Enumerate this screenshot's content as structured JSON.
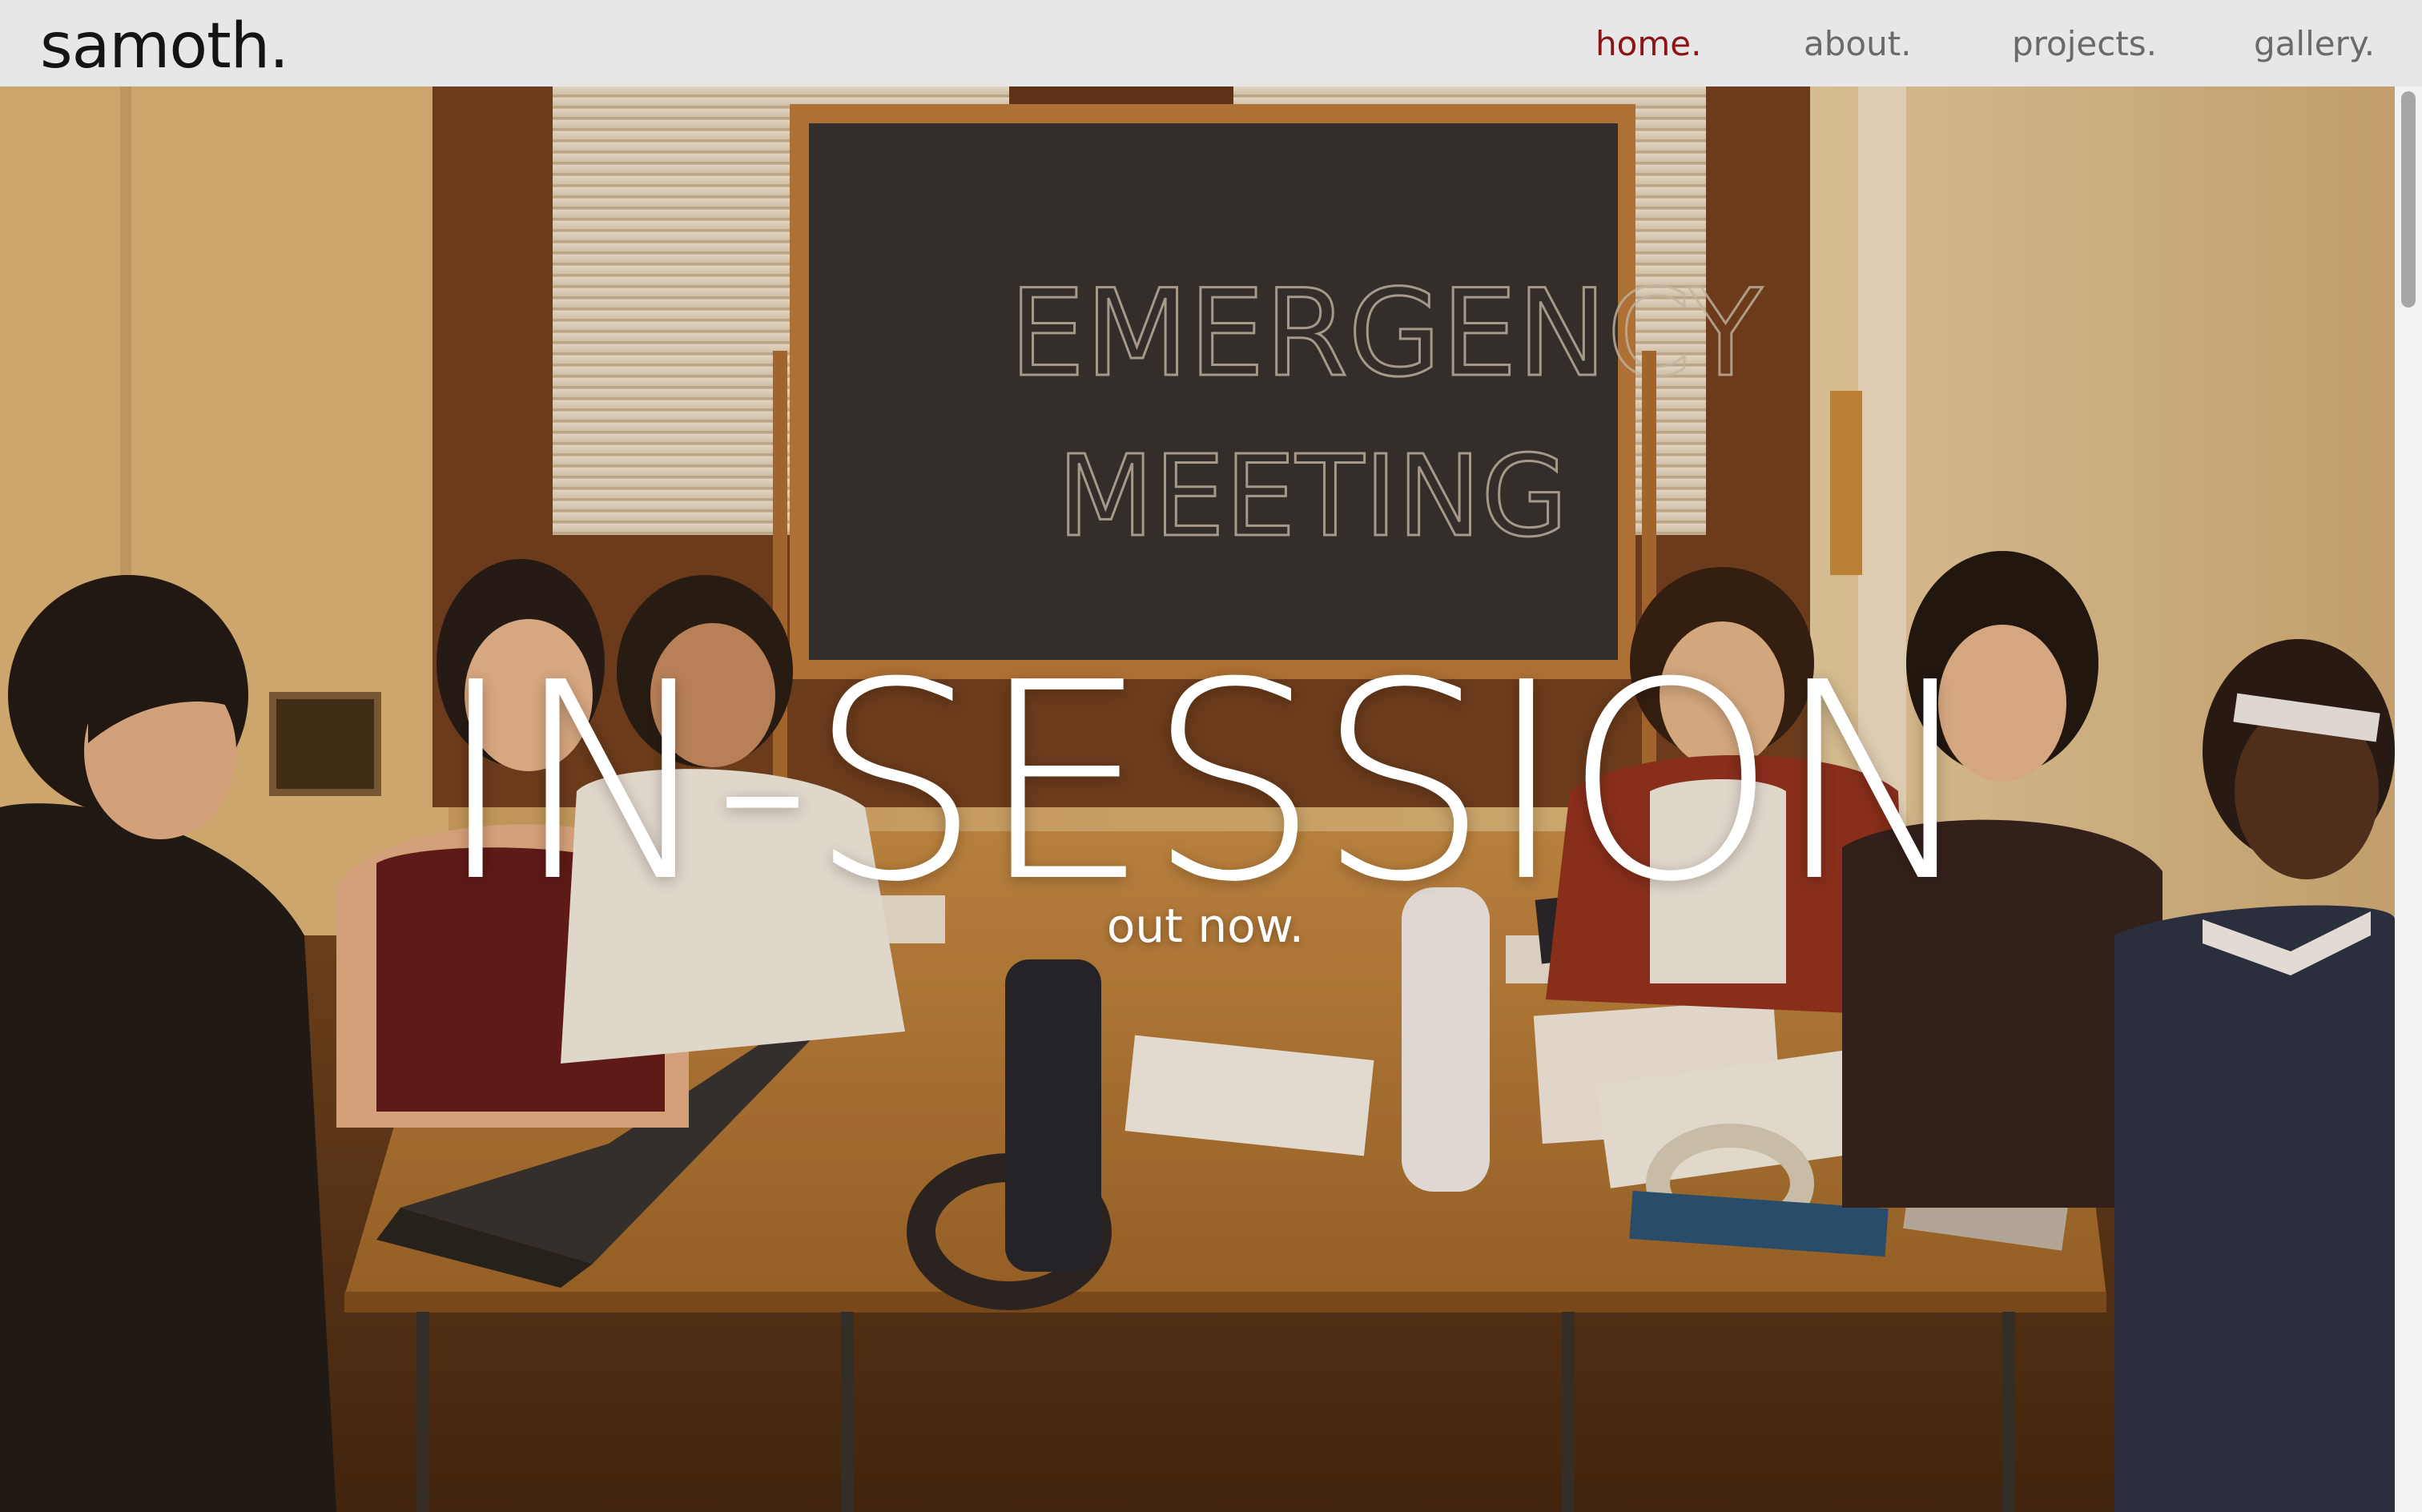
{
  "header": {
    "logo": "samoth.",
    "nav": [
      {
        "label": "home.",
        "active": true
      },
      {
        "label": "about.",
        "active": false
      },
      {
        "label": "projects.",
        "active": false
      },
      {
        "label": "gallery.",
        "active": false
      }
    ]
  },
  "hero": {
    "title": "IN-SESSION",
    "subtitle": "out now.",
    "chalkboard_text": [
      "EMERGENCY",
      "MEETING"
    ]
  },
  "colors": {
    "nav_active": "#8c1414",
    "nav_inactive": "#6a6a6a",
    "header_bg": "#e7e7e7",
    "logo": "#141414"
  },
  "scrollbar": {
    "position_fraction": 0
  }
}
